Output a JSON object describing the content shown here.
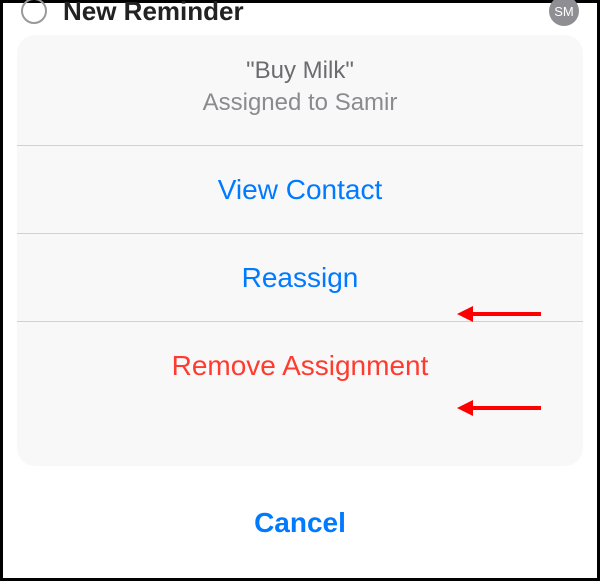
{
  "background": {
    "row_title": "New Reminder",
    "avatar_initials": "SM"
  },
  "sheet": {
    "title": "\"Buy Milk\"",
    "subtitle": "Assigned to Samir",
    "actions": {
      "view_contact": "View Contact",
      "reassign": "Reassign",
      "remove_assignment": "Remove Assignment"
    },
    "cancel": "Cancel"
  },
  "colors": {
    "ios_blue": "#007aff",
    "ios_red": "#ff3b30",
    "sheet_bg": "#f8f8f8",
    "arrow": "#ff0000"
  }
}
